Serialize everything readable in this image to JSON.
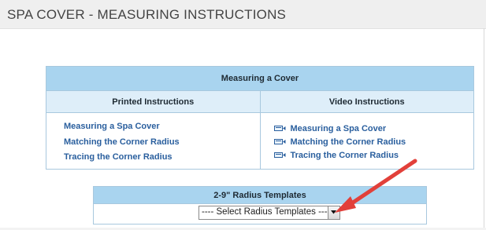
{
  "header": {
    "title": "SPA COVER - MEASURING INSTRUCTIONS"
  },
  "measuring": {
    "title": "Measuring a Cover",
    "printed": {
      "heading": "Printed Instructions",
      "links": [
        "Measuring a Spa Cover",
        "Matching the Corner Radius",
        "Tracing the Corner Radius"
      ]
    },
    "video": {
      "heading": "Video Instructions",
      "links": [
        "Measuring a Spa Cover",
        "Matching the Corner Radius",
        "Tracing the Corner Radius"
      ],
      "icon": "video-camera-icon"
    }
  },
  "radius_templates": {
    "title": "2-9\" Radius Templates",
    "select_value": "---- Select Radius Templates ----"
  },
  "colors": {
    "title_bar": "#a9d4ef",
    "sub_header": "#deeef9",
    "link": "#2a5f9e",
    "callout_arrow": "#e2403a"
  }
}
